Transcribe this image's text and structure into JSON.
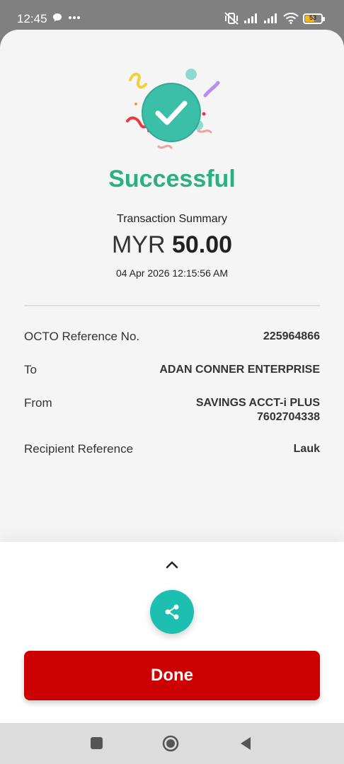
{
  "status_bar": {
    "time": "12:45",
    "battery_level": "53"
  },
  "receipt": {
    "title": "Successful",
    "summary_label": "Transaction Summary",
    "currency": "MYR",
    "amount": "50.00",
    "datetime": "04 Apr 2026 12:15:56 AM",
    "details": [
      {
        "label": "OCTO Reference No.",
        "value": [
          "225964866"
        ]
      },
      {
        "label": "To",
        "value": [
          "ADAN CONNER ENTERPRISE"
        ]
      },
      {
        "label": "From",
        "value": [
          "SAVINGS ACCT-i PLUS",
          "7602704338"
        ]
      },
      {
        "label": "Recipient Reference",
        "value": [
          "Lauk"
        ]
      }
    ]
  },
  "actions": {
    "done_label": "Done"
  },
  "colors": {
    "success": "#2bb07f",
    "share_button": "#1dbfb0",
    "done_button": "#cc0000",
    "check_circle": "#3cbfa8"
  },
  "icons": {
    "expand": "chevron-up-icon",
    "share": "share-icon",
    "success": "check-circle-icon"
  }
}
